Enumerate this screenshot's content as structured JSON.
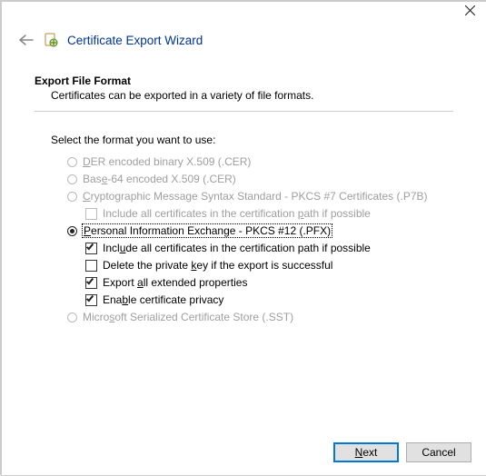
{
  "titlebar": {
    "close_aria": "Close"
  },
  "header": {
    "back_aria": "Back",
    "title": "Certificate Export Wizard"
  },
  "section": {
    "heading": "Export File Format",
    "sub": "Certificates can be exported in a variety of file formats."
  },
  "prompt": "Select the format you want to use:",
  "options": {
    "der": {
      "pre": "",
      "u": "D",
      "post": "ER encoded binary X.509 (.CER)"
    },
    "b64": {
      "pre": "Bas",
      "u": "e",
      "post": "-64 encoded X.509 (.CER)"
    },
    "p7b": {
      "pre": "",
      "u": "C",
      "post": "ryptographic Message Syntax Standard - PKCS #7 Certificates (.P7B)"
    },
    "p7b_inc": {
      "pre": "Include all certificates in the certification ",
      "u": "p",
      "post": "ath if possible"
    },
    "pfx": {
      "pre": "",
      "u": "P",
      "post": "ersonal Information Exchange - PKCS #12 (.PFX)"
    },
    "pfx_inc": {
      "pre": "Incl",
      "u": "u",
      "post": "de all certificates in the certification path if possible"
    },
    "pfx_del": {
      "pre": "Delete the private ",
      "u": "k",
      "post": "ey if the export is successful"
    },
    "pfx_ext": {
      "pre": "Export ",
      "u": "a",
      "post": "ll extended properties"
    },
    "pfx_priv": {
      "pre": "Ena",
      "u": "b",
      "post": "le certificate privacy"
    },
    "sst": {
      "pre": "Micro",
      "u": "s",
      "post": "oft Serialized Certificate Store (.SST)"
    }
  },
  "footer": {
    "next": {
      "u": "N",
      "post": "ext"
    },
    "cancel": "Cancel"
  }
}
